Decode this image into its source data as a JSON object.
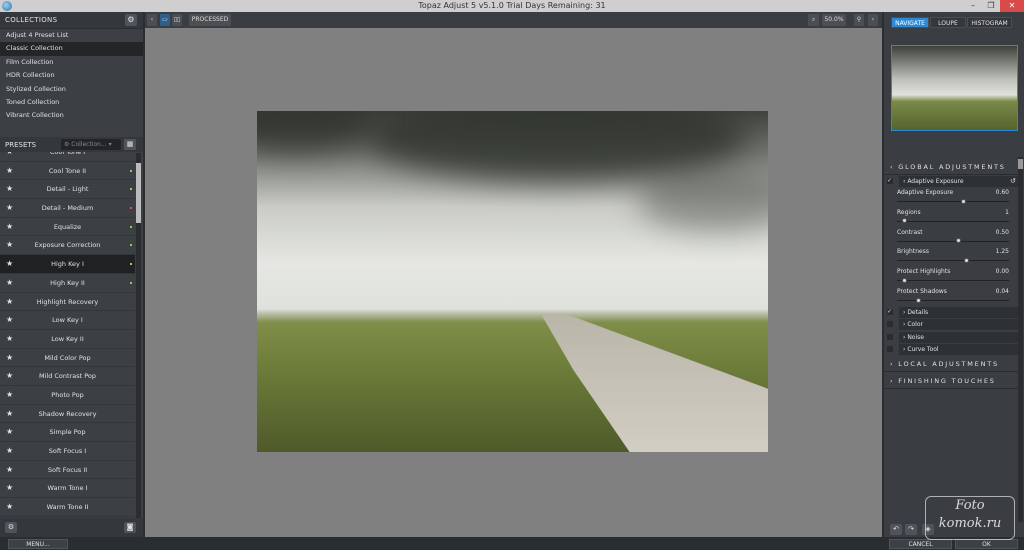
{
  "window": {
    "title": "Topaz Adjust 5 v5.1.0    Trial Days Remaining: 31",
    "minimize": "–",
    "restore": "❐",
    "close": "✕"
  },
  "collections": {
    "header": "COLLECTIONS",
    "items": [
      "Adjust 4 Preset List",
      "Classic Collection",
      "Film Collection",
      "HDR Collection",
      "Stylized Collection",
      "Toned Collection",
      "Vibrant Collection"
    ],
    "selected": "Classic Collection"
  },
  "presets": {
    "header": "PRESETS",
    "dropdown": "Collection...",
    "items": [
      {
        "label": "Cool Tone I",
        "dot": ""
      },
      {
        "label": "Cool Tone II",
        "dot": "#8fd14f"
      },
      {
        "label": "Detail - Light",
        "dot": "#8fd14f"
      },
      {
        "label": "Detail - Medium",
        "dot": "#d9534f"
      },
      {
        "label": "Equalize",
        "dot": "#8fd14f"
      },
      {
        "label": "Exposure Correction",
        "dot": "#8fd14f"
      },
      {
        "label": "High Key I",
        "dot": "#8fd14f"
      },
      {
        "label": "High Key II",
        "dot": "#8fd14f"
      },
      {
        "label": "Highlight Recovery",
        "dot": ""
      },
      {
        "label": "Low Key I",
        "dot": ""
      },
      {
        "label": "Low Key II",
        "dot": ""
      },
      {
        "label": "Mild Color Pop",
        "dot": ""
      },
      {
        "label": "Mild Contrast Pop",
        "dot": ""
      },
      {
        "label": "Photo Pop",
        "dot": ""
      },
      {
        "label": "Shadow Recovery",
        "dot": ""
      },
      {
        "label": "Simple Pop",
        "dot": ""
      },
      {
        "label": "Soft Focus I",
        "dot": ""
      },
      {
        "label": "Soft Focus II",
        "dot": ""
      },
      {
        "label": "Warm Tone I",
        "dot": ""
      },
      {
        "label": "Warm Tone II",
        "dot": ""
      }
    ],
    "selected": "High Key I"
  },
  "toolbar": {
    "processed": "PROCESSED",
    "zoom": "50.0%"
  },
  "navigator": {
    "tabs": [
      "NAVIGATE",
      "LOUPE",
      "HISTOGRAM"
    ],
    "active": "NAVIGATE"
  },
  "adjustments": {
    "global": "GLOBAL ADJUSTMENTS",
    "adaptive": "Adaptive Exposure",
    "sliders": [
      {
        "label": "Adaptive Exposure",
        "value": "0.60",
        "pos": 0.6
      },
      {
        "label": "Regions",
        "value": "1",
        "pos": 0.05
      },
      {
        "label": "Contrast",
        "value": "0.50",
        "pos": 0.55
      },
      {
        "label": "Brightness",
        "value": "1.25",
        "pos": 0.63
      },
      {
        "label": "Protect Highlights",
        "value": "0.00",
        "pos": 0.05
      },
      {
        "label": "Protect Shadows",
        "value": "0.04",
        "pos": 0.18
      }
    ],
    "subsections": [
      {
        "label": "Details",
        "checked": true
      },
      {
        "label": "Color",
        "checked": false
      },
      {
        "label": "Noise",
        "checked": false
      },
      {
        "label": "Curve Tool",
        "checked": false
      }
    ],
    "local": "LOCAL ADJUSTMENTS",
    "finishing": "FINISHING TOUCHES"
  },
  "footer": {
    "menu": "MENU...",
    "cancel": "CANCEL",
    "ok": "OK"
  },
  "watermark": "Foto komok.ru",
  "accent": "#2a8ad8"
}
